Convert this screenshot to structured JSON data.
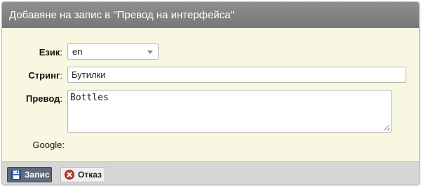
{
  "dialog": {
    "title": "Добавяне на запис в \"Превод на интерфейса\""
  },
  "form": {
    "language": {
      "label": "Език",
      "value": "en"
    },
    "string": {
      "label": "Стринг",
      "value": "Бутилки"
    },
    "translation": {
      "label": "Превод",
      "value": "Bottles"
    },
    "google": {
      "label": "Google:"
    }
  },
  "buttons": {
    "save": {
      "label": "Запис",
      "icon": "floppy-disk-icon"
    },
    "cancel": {
      "label": "Отказ",
      "icon": "cancel-icon"
    }
  },
  "colors": {
    "titlebar": "#848484",
    "body": "#f8f7e1",
    "footer": "#d6d6d6",
    "save_button": "#5d6b7c",
    "cancel_icon": "#c0392b"
  }
}
